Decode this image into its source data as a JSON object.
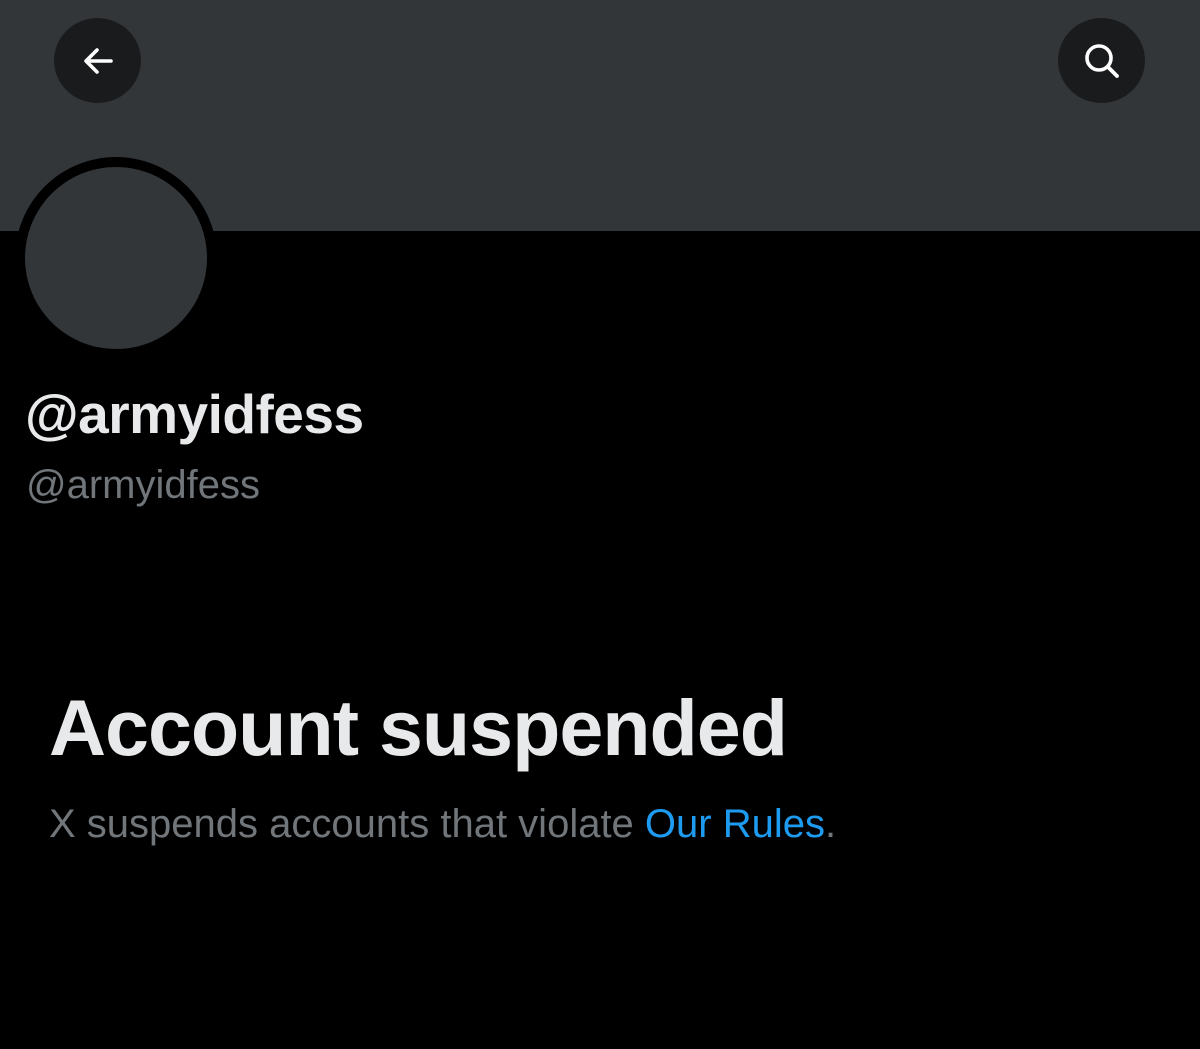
{
  "header": {
    "back_icon": "arrow-left-icon",
    "search_icon": "search-icon"
  },
  "profile": {
    "display_name": "@armyidfess",
    "handle": "@armyidfess"
  },
  "suspension": {
    "title": "Account suspended",
    "description_prefix": "X suspends accounts that violate ",
    "rules_link_label": "Our Rules",
    "description_suffix": "."
  },
  "colors": {
    "background": "#000000",
    "banner": "#333639",
    "primary_text": "#e7e9ea",
    "secondary_text": "#71767b",
    "link": "#1d9bf0"
  }
}
